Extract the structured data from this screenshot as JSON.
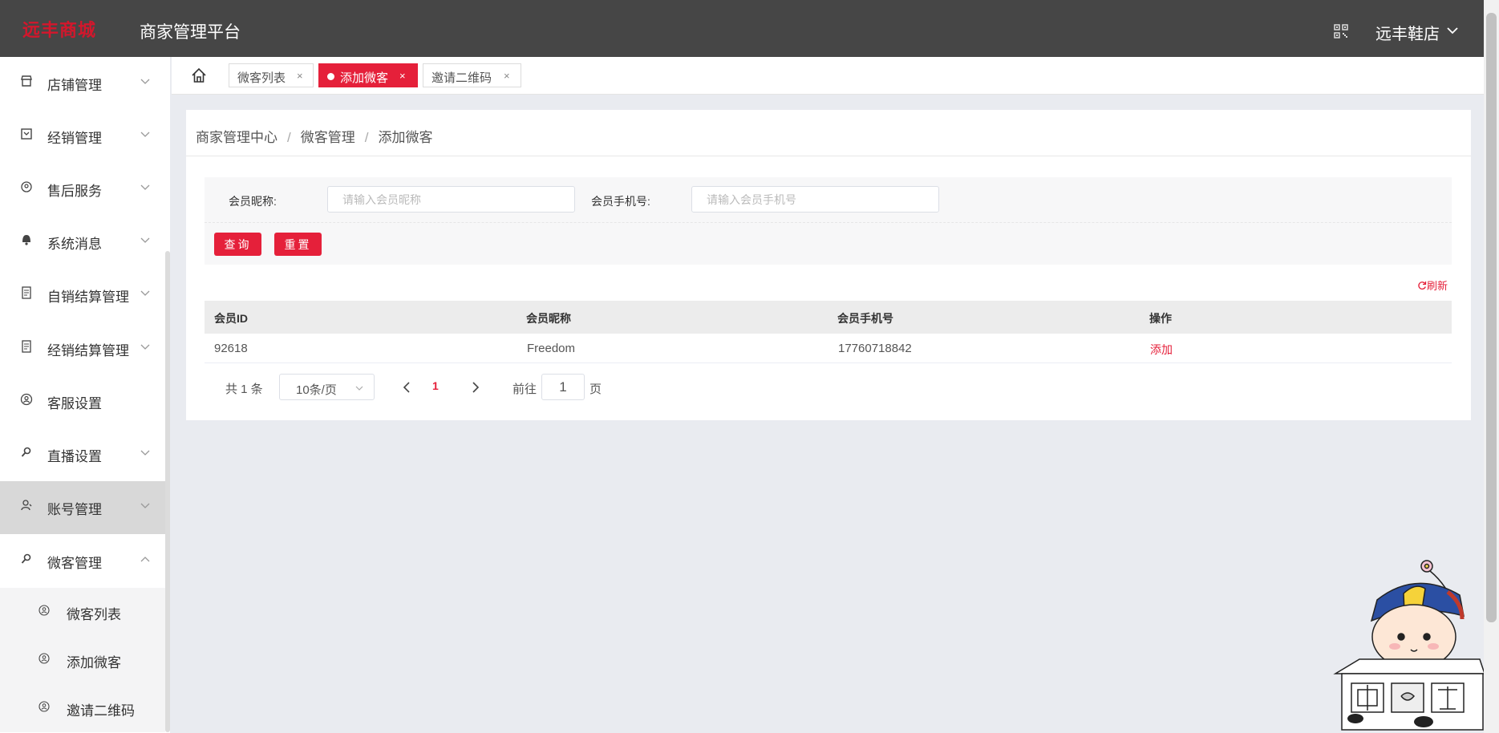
{
  "header": {
    "logo_text": "远丰商城",
    "platform_title": "商家管理平台",
    "shop_name": "远丰鞋店"
  },
  "sidebar": {
    "items": [
      {
        "label": "店铺管理",
        "icon": "store-icon",
        "expandable": true
      },
      {
        "label": "经销管理",
        "icon": "box-icon",
        "expandable": true
      },
      {
        "label": "售后服务",
        "icon": "service-icon",
        "expandable": true
      },
      {
        "label": "系统消息",
        "icon": "bell-icon",
        "expandable": true
      },
      {
        "label": "自销结算管理",
        "icon": "ledger-icon",
        "expandable": true
      },
      {
        "label": "经销结算管理",
        "icon": "ledger-icon",
        "expandable": true
      },
      {
        "label": "客服设置",
        "icon": "user-icon",
        "expandable": false
      },
      {
        "label": "直播设置",
        "icon": "key-icon",
        "expandable": true
      },
      {
        "label": "账号管理",
        "icon": "account-icon",
        "expandable": true,
        "highlighted": true
      },
      {
        "label": "微客管理",
        "icon": "key-icon",
        "expandable": true,
        "expanded": true
      }
    ],
    "sub_items": [
      {
        "label": "微客列表"
      },
      {
        "label": "添加微客"
      },
      {
        "label": "邀请二维码"
      }
    ]
  },
  "tabs": [
    {
      "label": "微客列表",
      "active": false
    },
    {
      "label": "添加微客",
      "active": true
    },
    {
      "label": "邀请二维码",
      "active": false
    }
  ],
  "breadcrumb": [
    "商家管理中心",
    "微客管理",
    "添加微客"
  ],
  "filter": {
    "nickname_label": "会员昵称:",
    "nickname_placeholder": "请输入会员昵称",
    "phone_label": "会员手机号:",
    "phone_placeholder": "请输入会员手机号",
    "query_label": "查询",
    "reset_label": "重置"
  },
  "refresh_label": "刷新",
  "table": {
    "columns": [
      "会员ID",
      "会员昵称",
      "会员手机号",
      "操作"
    ],
    "rows": [
      {
        "id": "92618",
        "nickname": "Freedom",
        "phone": "17760718842",
        "action": "添加"
      }
    ]
  },
  "pagination": {
    "total": "共 1 条",
    "page_size": "10条/页",
    "current_page": "1",
    "goto_label": "前往",
    "goto_value": "1",
    "page_unit": "页"
  },
  "colors": {
    "accent": "#e5203a",
    "header_bg": "#464646"
  }
}
